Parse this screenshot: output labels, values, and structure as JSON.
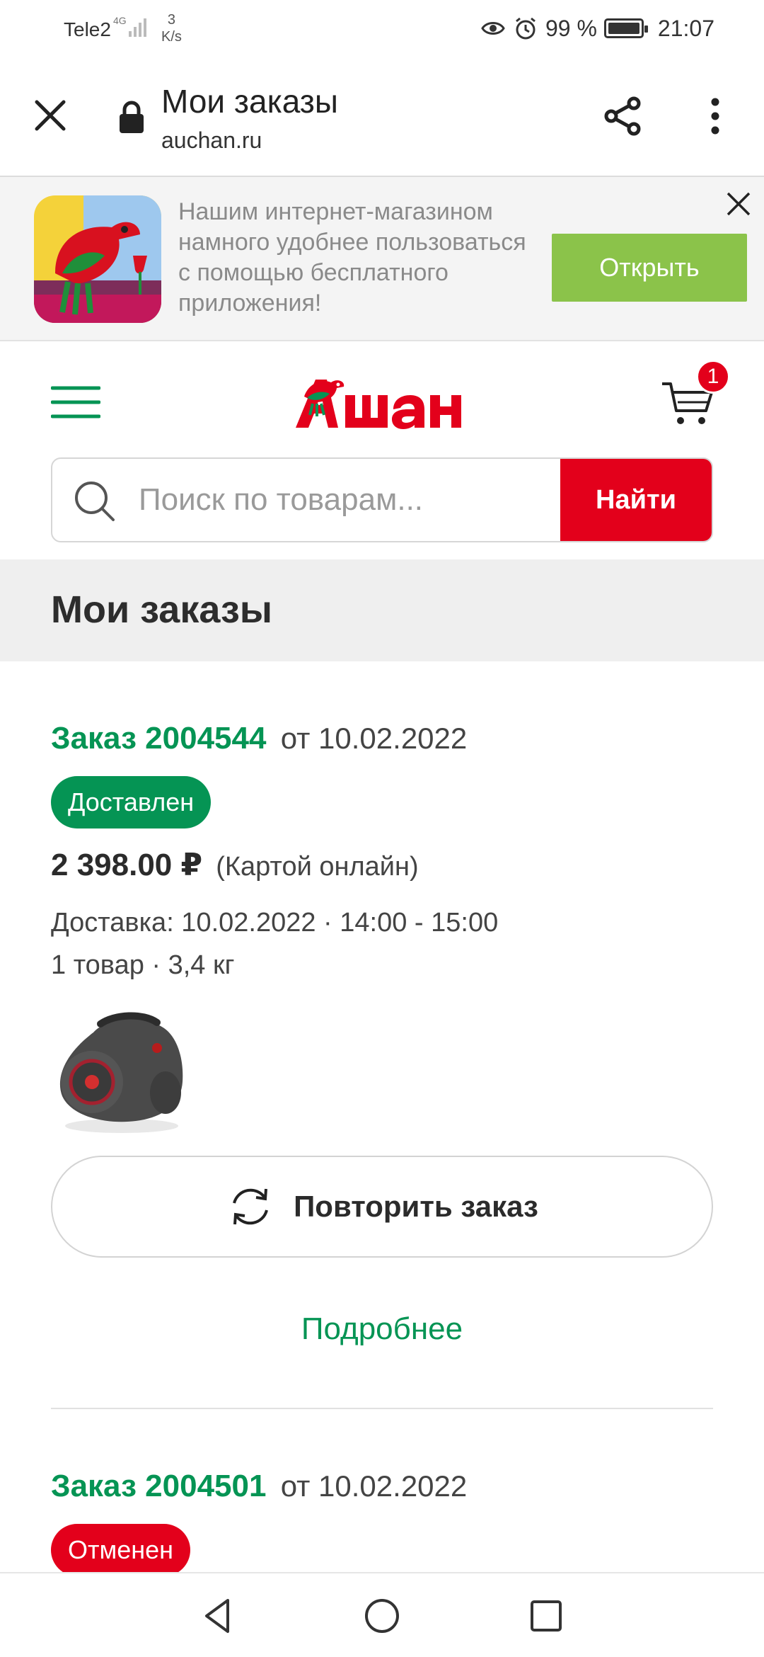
{
  "status_bar": {
    "carrier": "Tele2",
    "network": "4G",
    "speed_value": "3",
    "speed_unit": "K/s",
    "battery": "99 %",
    "time": "21:07"
  },
  "browser": {
    "title": "Мои заказы",
    "url": "auchan.ru"
  },
  "app_banner": {
    "text": "Нашим интернет-магазином намного удобнее пользоваться с помощью бесплатного приложения!",
    "open_label": "Открыть"
  },
  "header": {
    "cart_count": "1"
  },
  "search": {
    "placeholder": "Поиск по товарам...",
    "button_label": "Найти"
  },
  "page": {
    "title": "Мои заказы"
  },
  "orders": [
    {
      "number": "Заказ 2004544",
      "date": "от 10.02.2022",
      "status": "Доставлен",
      "price": "2 398.00 ₽",
      "payment": "(Картой онлайн)",
      "delivery": "Доставка: 10.02.2022 · 14:00 - 15:00",
      "items": "1 товар · 3,4 кг",
      "repeat_label": "Повторить заказ",
      "details_label": "Подробнее"
    },
    {
      "number": "Заказ 2004501",
      "date": "от 10.02.2022",
      "status": "Отменен"
    }
  ],
  "colors": {
    "brand_red": "#e3001b",
    "brand_green": "#059454",
    "banner_button": "#8bc34a"
  }
}
